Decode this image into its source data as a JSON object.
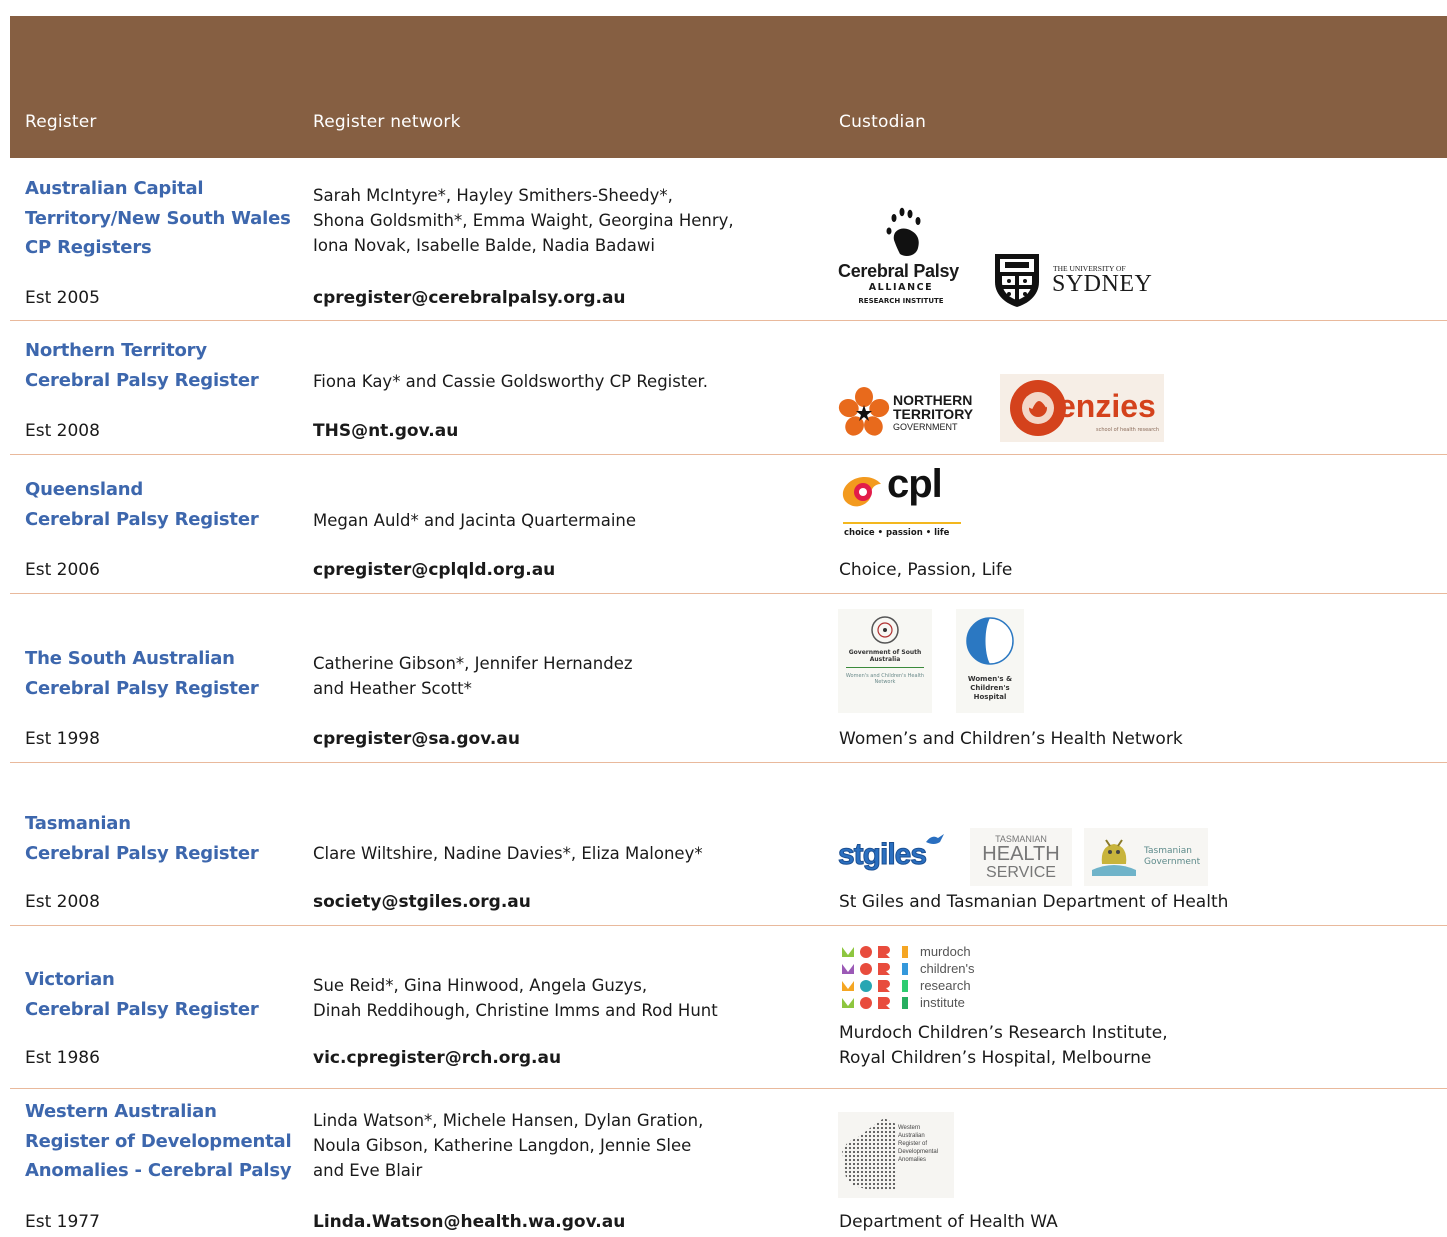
{
  "header": {
    "col_register": "Register",
    "col_network": "Register network",
    "col_custodian": "Custodian"
  },
  "rows": [
    {
      "register": [
        "Australian Capital",
        "Territory/New South Wales",
        "CP Registers"
      ],
      "est": "Est 2005",
      "network": [
        "Sarah McIntyre*, Hayley Smithers-Sheedy*,",
        "Shona Goldsmith*, Emma Waight, Georgina Henry,",
        "Iona Novak, Isabelle Balde, Nadia Badawi"
      ],
      "email": "cpregister@cerebralpalsy.org.au",
      "logos": {
        "cpa_name": "Cerebral Palsy",
        "cpa_sub": "ALLIANCE",
        "cpa_sub2": "RESEARCH INSTITUTE",
        "usyd_small": "THE UNIVERSITY OF",
        "usyd_big": "SYDNEY"
      }
    },
    {
      "register": [
        "Northern Territory",
        "Cerebral Palsy Register"
      ],
      "est": "Est 2008",
      "network": [
        "Fiona Kay* and Cassie Goldsworthy CP Register."
      ],
      "email": "THS@nt.gov.au",
      "logos": {
        "nt_line1": "NORTHERN",
        "nt_line2": "TERRITORY",
        "nt_line3": "GOVERNMENT",
        "menzies": "enzies",
        "menzies_sub": "school of health research"
      }
    },
    {
      "register": [
        "Queensland",
        "Cerebral Palsy Register"
      ],
      "est": "Est 2006",
      "network": [
        "Megan Auld* and Jacinta Quartermaine"
      ],
      "email": "cpregister@cplqld.org.au",
      "custodian": [
        "Choice, Passion, Life"
      ],
      "logos": {
        "cpl": "cpl",
        "cpl_tag": "choice • passion • life"
      }
    },
    {
      "register": [
        "The South Australian",
        "Cerebral Palsy Register"
      ],
      "est": "Est 1998",
      "network": [
        "Catherine Gibson*, Jennifer Hernandez",
        "and Heather Scott*"
      ],
      "email": "cpregister@sa.gov.au",
      "custodian": [
        "Women’s and Children’s Health Network"
      ],
      "logos": {
        "sa_gov": "Government of South Australia",
        "sa_net": "Women's and Children's Health Network",
        "wch": "Women's & Children's Hospital"
      }
    },
    {
      "register": [
        "Tasmanian",
        "Cerebral Palsy Register"
      ],
      "est": "Est 2008",
      "network": [
        "Clare Wiltshire, Nadine Davies*, Eliza Maloney*"
      ],
      "email": "society@stgiles.org.au",
      "custodian": [
        "St Giles and Tasmanian Department of Health"
      ],
      "logos": {
        "stgiles": "stgiles",
        "ths1": "TASMANIAN",
        "ths2": "HEALTH",
        "ths3": "SERVICE",
        "tasgov1": "Tasmanian",
        "tasgov2": "Government"
      }
    },
    {
      "register": [
        "Victorian",
        "Cerebral Palsy Register"
      ],
      "est": "Est 1986",
      "network": [
        "Sue Reid*, Gina Hinwood, Angela Guzys,",
        "Dinah Reddihough, Christine Imms and Rod Hunt"
      ],
      "email": "vic.cpregister@rch.org.au",
      "custodian": [
        "Murdoch Children’s Research Institute,",
        "Royal Children’s Hospital, Melbourne"
      ],
      "logos": {
        "mcri": [
          "murdoch",
          "children's",
          "research",
          "institute"
        ]
      }
    },
    {
      "register": [
        "Western Australian",
        "Register of Developmental",
        "Anomalies - Cerebral Palsy"
      ],
      "est": "Est 1977",
      "network": [
        "Linda Watson*, Michele Hansen, Dylan Gration,",
        "Noula Gibson, Katherine Langdon, Jennie Slee",
        "and Eve Blair"
      ],
      "email": "Linda.Watson@health.wa.gov.au",
      "custodian": [
        "Department of Health WA"
      ],
      "logos": {
        "wa": [
          "Western",
          "Australian",
          "Register of",
          "Developmental",
          "Anomalies"
        ]
      }
    }
  ],
  "colors": {
    "header_bg": "#865f42",
    "register_blue": "#3d67ad",
    "row_divider": "#e9b99c"
  }
}
